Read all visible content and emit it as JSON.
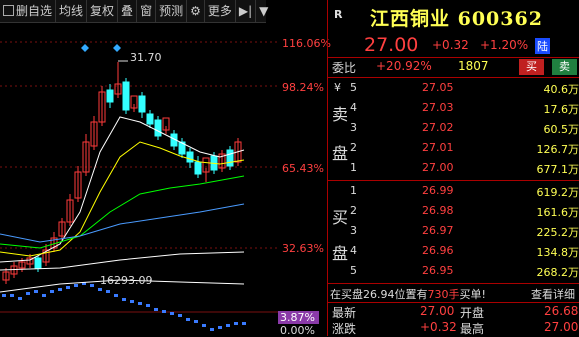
{
  "toolbar": {
    "items": [
      "删自选",
      "均线",
      "复权",
      "叠",
      "窗",
      "预测",
      "",
      "更多"
    ],
    "icons": [
      "checkbox-icon",
      "play-step-icon"
    ]
  },
  "chart": {
    "pct_labels": [
      "116.06%",
      "98.24%",
      "65.43%",
      "32.63%",
      "3.87%",
      "0.00%"
    ],
    "high_label": "31.70",
    "low_label": "16293.09",
    "colors": {
      "up": "#ff3b3b",
      "down": "#33ffff",
      "ma1": "#ffffff",
      "ma2": "#ffff00",
      "ma3": "#00ff00",
      "ma4": "#4a9bff",
      "pct_red": "#ff4040",
      "highlight_bg": "#8a3aa8"
    }
  },
  "quote": {
    "r_marker": "R",
    "name_code": "江西铜业 600362",
    "price": "27.00",
    "change": "+0.32",
    "change_pct": "+1.20%",
    "exchange_tag": "陆",
    "webi_label": "委比",
    "webi_value": "+20.92%",
    "webi_diff": "1807",
    "buy_btn": "买",
    "sell_btn": "卖",
    "sell_side_label": [
      "卖",
      "盘"
    ],
    "buy_side_label": [
      "买",
      "盘"
    ],
    "yen": "¥",
    "sell_rows": [
      {
        "level": "5",
        "price": "27.05",
        "vol": "40.6万"
      },
      {
        "level": "4",
        "price": "27.03",
        "vol": "17.6万"
      },
      {
        "level": "3",
        "price": "27.02",
        "vol": "60.5万"
      },
      {
        "level": "2",
        "price": "27.01",
        "vol": "126.7万"
      },
      {
        "level": "1",
        "price": "27.00",
        "vol": "677.1万"
      }
    ],
    "buy_rows": [
      {
        "level": "1",
        "price": "26.99",
        "vol": "619.2万"
      },
      {
        "level": "2",
        "price": "26.98",
        "vol": "161.6万"
      },
      {
        "level": "3",
        "price": "26.97",
        "vol": "225.2万"
      },
      {
        "level": "4",
        "price": "26.96",
        "vol": "134.8万"
      },
      {
        "level": "5",
        "price": "26.95",
        "vol": "268.2万"
      }
    ],
    "notice_pre": "在买盘26.94位置有",
    "notice_vol": "730手",
    "notice_post": "买单!",
    "view_detail": "查看详细",
    "latest_label": "最新",
    "latest_value": "27.00",
    "open_label": "开盘",
    "open_value": "26.68",
    "change_label": "涨跌",
    "change_value": "+0.32",
    "high_lbl": "最高",
    "high_value": "27.00"
  }
}
